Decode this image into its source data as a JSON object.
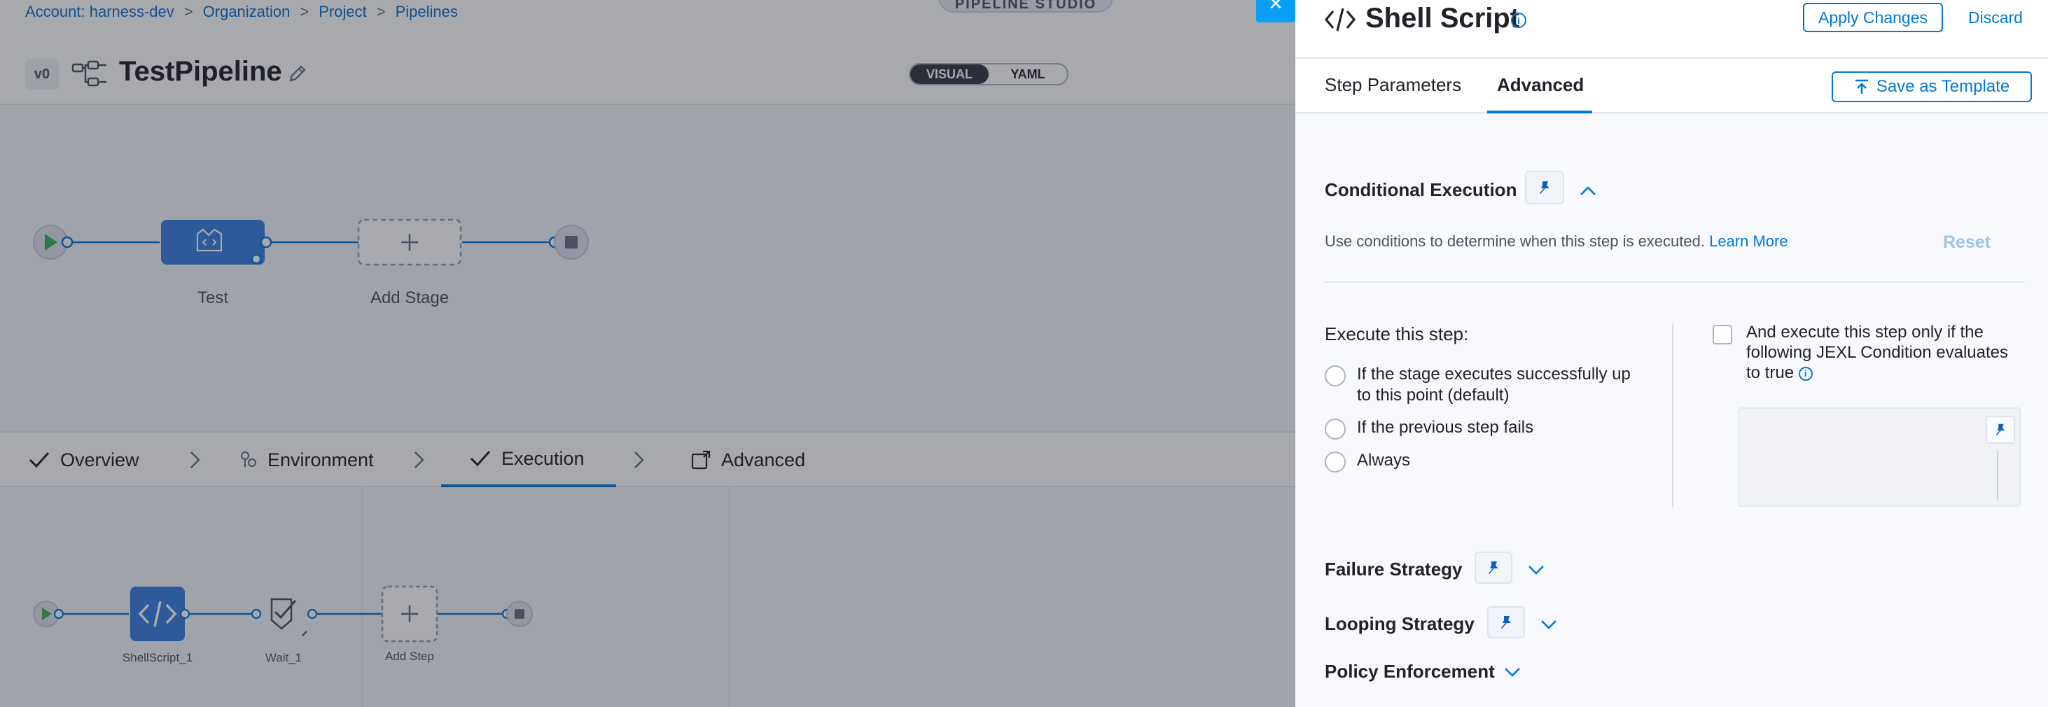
{
  "breadcrumb": {
    "items": [
      "Account: harness-dev",
      "Organization",
      "Project",
      "Pipelines"
    ],
    "separator": ">"
  },
  "studio": {
    "banner_label": "PIPELINE STUDIO",
    "version_badge": "v0",
    "pipeline_name": "TestPipeline",
    "view_toggle": {
      "visual": "VISUAL",
      "yaml": "YAML",
      "selected": "VISUAL"
    },
    "stages": [
      {
        "label": "Test"
      },
      {
        "label": "Add Stage"
      }
    ],
    "stage_tabs": [
      {
        "label": "Overview",
        "icon": "check-icon"
      },
      {
        "label": "Environment",
        "icon": "environment-icon"
      },
      {
        "label": "Execution",
        "icon": "check-icon",
        "active": true
      },
      {
        "label": "Advanced",
        "icon": "advanced-icon"
      }
    ],
    "steps": [
      {
        "label": "ShellScript_1"
      },
      {
        "label": "Wait_1"
      },
      {
        "label": "Add Step"
      }
    ],
    "close_label": "×"
  },
  "drawer": {
    "title": "Shell Script",
    "info_glyph": "i",
    "apply_label": "Apply Changes",
    "discard_label": "Discard",
    "tabs": [
      {
        "label": "Step Parameters"
      },
      {
        "label": "Advanced",
        "active": true
      }
    ],
    "save_template_label": "Save as Template",
    "conditional": {
      "title": "Conditional Execution",
      "description": "Use conditions to determine when this step is executed.",
      "learn_more": "Learn More",
      "reset_label": "Reset",
      "execute_label": "Execute this step:",
      "options": [
        "If the stage executes successfully up to this point (default)",
        "If the previous step fails",
        "Always"
      ],
      "jexl_label": "And execute this step only if the following JEXL Condition evaluates to true"
    },
    "failure_strategy": {
      "title": "Failure Strategy"
    },
    "looping_strategy": {
      "title": "Looping Strategy"
    },
    "policy_enforcement": {
      "title": "Policy Enforcement"
    }
  },
  "colors": {
    "accent": "#0278d5",
    "node_blue": "#3a7fe0",
    "overlay": "#1a1c28"
  }
}
